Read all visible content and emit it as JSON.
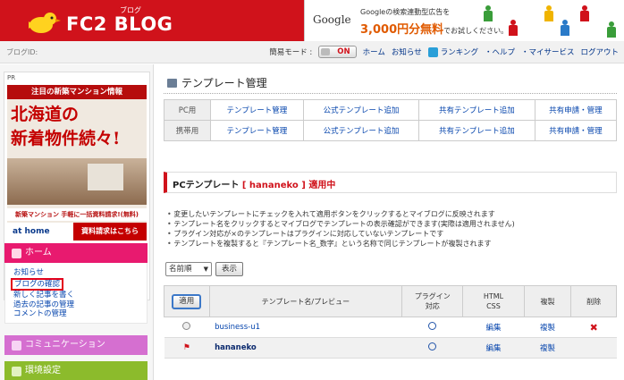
{
  "header": {
    "logo_text": "FC2 BLOG",
    "logo_ruby": "ブログ",
    "ad": {
      "google": "Google",
      "line1": "Googleの検索連動型広告を",
      "line2_amount": "3,000円分無料",
      "line2_suffix": "でお試しください。"
    }
  },
  "utilbar": {
    "blog_id_label": "ブログID:",
    "simple_mode_label": "簡易モード :",
    "simple_mode_value": "ON",
    "links": [
      "ホーム",
      "お知らせ",
      "ランキング",
      "・ヘルプ",
      "・マイサービス",
      "ログアウト"
    ]
  },
  "sidebar": {
    "pr_label": "PR",
    "ad": {
      "top": "注目の新築マンション情報",
      "big1": "北海道の",
      "big2": "新着物件続々!",
      "caption": "新築マンション 手軽に一括資料請求!(無料)",
      "brand": "at home",
      "request": "資料請求はこちら"
    },
    "home": {
      "title": "ホーム",
      "links": [
        "お知らせ",
        "ブログの確認",
        "新しく記事を書く",
        "過去の記事の管理",
        "コメントの管理"
      ]
    },
    "communication": {
      "title": "コミュニケーション"
    },
    "environment": {
      "title": "環境設定"
    }
  },
  "main": {
    "page_title": "テンプレート管理",
    "nav_rows": [
      {
        "label": "PC用",
        "links": [
          "テンプレート管理",
          "公式テンプレート追加",
          "共有テンプレート追加",
          "共有申請・管理"
        ]
      },
      {
        "label": "携帯用",
        "links": [
          "テンプレート管理",
          "公式テンプレート追加",
          "共有テンプレート追加",
          "共有申請・管理"
        ]
      }
    ],
    "section": {
      "prefix": "PCテンプレート",
      "name": "[ hananeko ]",
      "suffix": "適用中"
    },
    "notes": [
      "変更したいテンプレートにチェックを入れて適用ボタンをクリックするとマイブログに反映されます",
      "テンプレート名をクリックするとマイブログでテンプレートの表示確認ができます(実際は適用されません)",
      "プラグイン対応が×のテンプレートはプラグインに対応していないテンプレートです",
      "テンプレートを複製すると『テンプレート名_数字』という名称で同じテンプレートが複製されます"
    ],
    "sort_select": "名前順",
    "show_button": "表示",
    "table": {
      "headers": {
        "apply": "適用",
        "name": "テンプレート名/プレビュー",
        "plugin1": "プラグイン",
        "plugin2": "対応",
        "html1": "HTML",
        "html2": "CSS",
        "copy": "複製",
        "delete": "削除"
      },
      "rows": [
        {
          "name": "business-u1",
          "edit": "編集",
          "copy": "複製",
          "active": false
        },
        {
          "name": "hananeko",
          "edit": "編集",
          "copy": "複製",
          "active": true
        }
      ]
    }
  }
}
